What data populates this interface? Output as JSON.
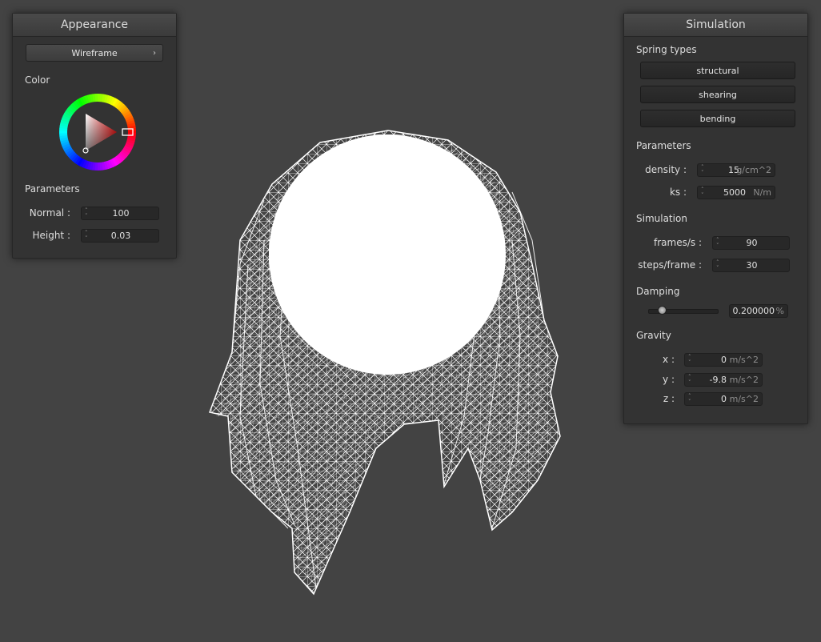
{
  "appearance": {
    "title": "Appearance",
    "shader_label": "Wireframe",
    "color_label": "Color",
    "parameters_label": "Parameters",
    "normal": {
      "label": "Normal :",
      "value": "100"
    },
    "height": {
      "label": "Height :",
      "value": "0.03"
    }
  },
  "simulation": {
    "title": "Simulation",
    "spring_types_label": "Spring types",
    "springs": [
      "structural",
      "shearing",
      "bending"
    ],
    "parameters_label": "Parameters",
    "density": {
      "label": "density :",
      "value": "15",
      "unit": "g/cm^2"
    },
    "ks": {
      "label": "ks :",
      "value": "5000",
      "unit": "N/m"
    },
    "simulation_label": "Simulation",
    "fps": {
      "label": "frames/s :",
      "value": "90"
    },
    "steps": {
      "label": "steps/frame :",
      "value": "30"
    },
    "damping_label": "Damping",
    "damping": {
      "value": "0.200000",
      "unit": "%",
      "slider_fraction": 0.2
    },
    "gravity_label": "Gravity",
    "gravity": [
      {
        "label": "x :",
        "value": "0",
        "unit": "m/s^2"
      },
      {
        "label": "y :",
        "value": "-9.8",
        "unit": "m/s^2"
      },
      {
        "label": "z :",
        "value": "0",
        "unit": "m/s^2"
      }
    ]
  },
  "icons": {
    "chevron": "chevron-right-icon",
    "spinner": "spinner-arrows-icon"
  },
  "colors": {
    "background": "#434343",
    "panel": "#333333",
    "mesh": "#ffffff",
    "selected_color": "#e01010"
  }
}
